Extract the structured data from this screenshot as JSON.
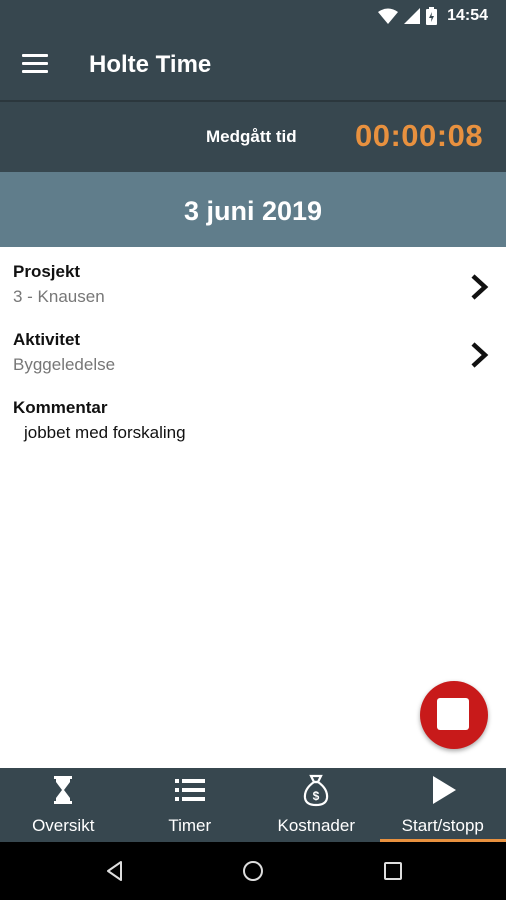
{
  "status_bar": {
    "time": "14:54"
  },
  "app_bar": {
    "title": "Holte Time"
  },
  "timer": {
    "label": "Medgått tid",
    "elapsed": "00:00:08"
  },
  "date": "3 juni 2019",
  "fields": {
    "project": {
      "label": "Prosjekt",
      "value": "3 - Knausen"
    },
    "activity": {
      "label": "Aktivitet",
      "value": "Byggeledelse"
    },
    "comment": {
      "label": "Kommentar",
      "value": "jobbet med forskaling"
    }
  },
  "bottom_nav": {
    "items": [
      {
        "label": "Oversikt",
        "icon": "hourglass-icon"
      },
      {
        "label": "Timer",
        "icon": "list-icon"
      },
      {
        "label": "Kostnader",
        "icon": "money-bag-icon"
      },
      {
        "label": "Start/stopp",
        "icon": "play-icon",
        "active": true
      }
    ]
  },
  "colors": {
    "primary": "#37474f",
    "date_bar": "#607d8b",
    "accent": "#e8913f",
    "stop_button": "#c81a1a"
  }
}
